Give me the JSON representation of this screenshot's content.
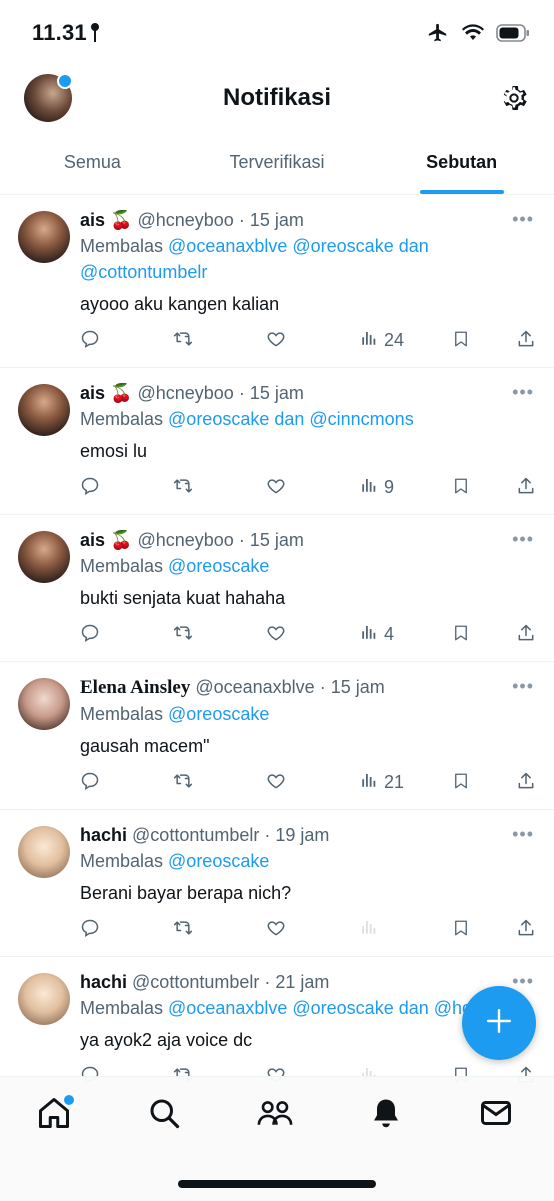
{
  "status": {
    "time": "11.31"
  },
  "header": {
    "title": "Notifikasi"
  },
  "tabs": [
    {
      "label": "Semua"
    },
    {
      "label": "Terverifikasi"
    },
    {
      "label": "Sebutan"
    }
  ],
  "tweets": [
    {
      "name": "ais 🍒",
      "handle": "@hcneyboo",
      "time": "· 15 jam",
      "reply_prefix": "Membalas ",
      "reply_to": "@oceanaxblve @oreoscake dan @cottontumbelr",
      "text": "ayooo aku kangen kalian",
      "views": "24"
    },
    {
      "name": "ais 🍒",
      "handle": "@hcneyboo",
      "time": "· 15 jam",
      "reply_prefix": "Membalas ",
      "reply_to": "@oreoscake dan @cinncmons",
      "text": "emosi lu",
      "views": "9"
    },
    {
      "name": "ais 🍒",
      "handle": "@hcneyboo",
      "time": "· 15 jam",
      "reply_prefix": "Membalas ",
      "reply_to": "@oreoscake",
      "text": "bukti senjata kuat hahaha",
      "views": "4"
    },
    {
      "name": "Elena Ainsley",
      "handle": "@oceanaxblve",
      "time": "· 15 jam",
      "reply_prefix": "Membalas ",
      "reply_to": "@oreoscake",
      "text": "gausah macem\"",
      "views": "21"
    },
    {
      "name": "hachi",
      "handle": "@cottontumbelr",
      "time": "· 19 jam",
      "reply_prefix": "Membalas ",
      "reply_to": "@oreoscake",
      "text": "Berani bayar berapa nich?",
      "views": ""
    },
    {
      "name": "hachi",
      "handle": "@cottontumbelr",
      "time": "· 21 jam",
      "reply_prefix": "Membalas ",
      "reply_to": "@oceanaxblve @oreoscake dan @hcneyboo",
      "text": "ya ayok2 aja voice dc",
      "views": ""
    }
  ],
  "more_label": "•••",
  "colors": {
    "accent": "#1d9bf0",
    "text": "#0f1419",
    "muted": "#536471"
  }
}
